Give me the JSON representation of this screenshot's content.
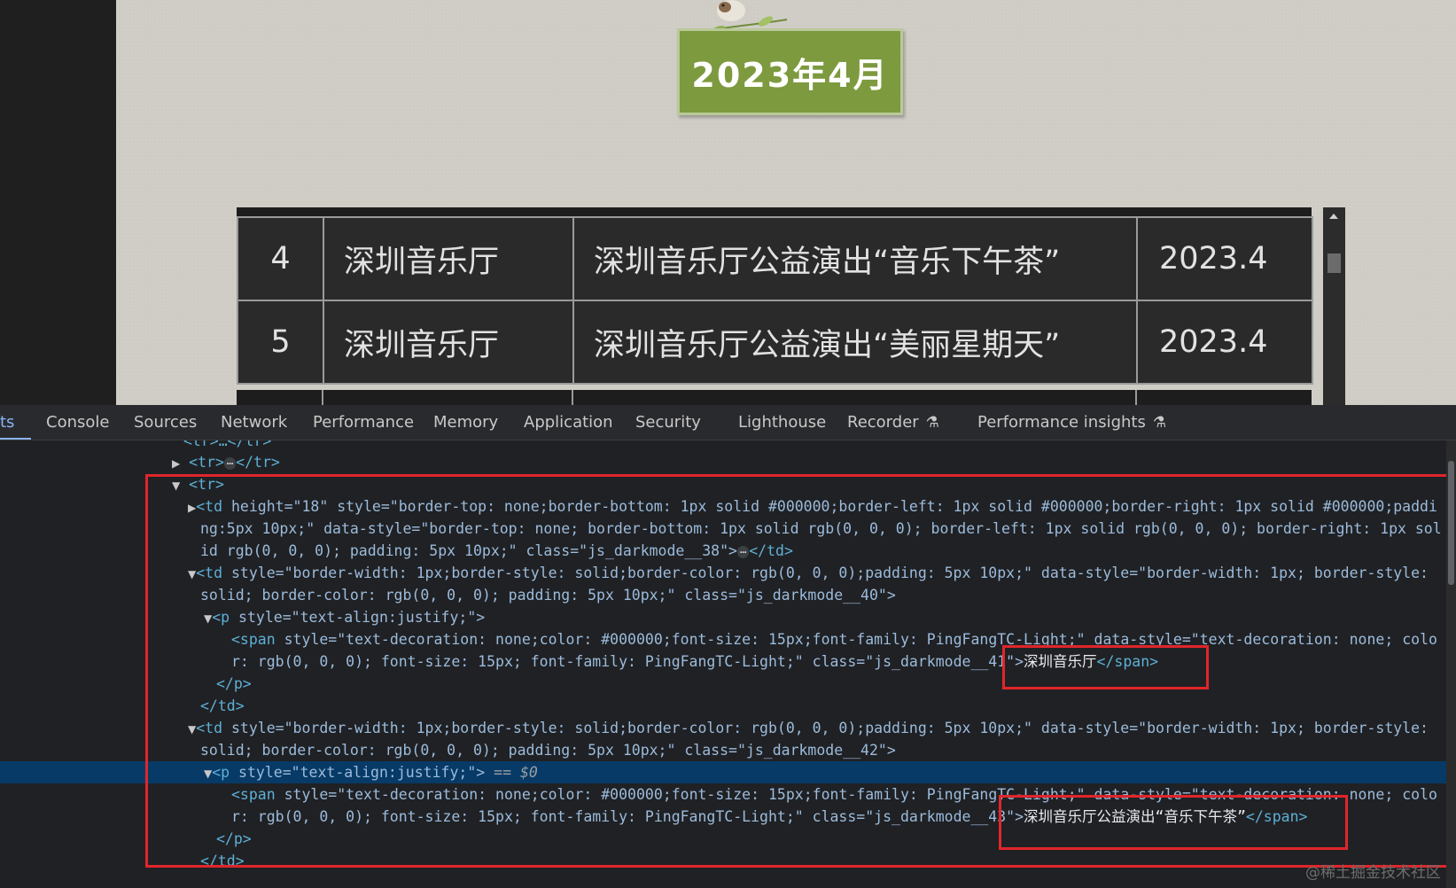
{
  "page": {
    "title": "2023年4月",
    "table_rows": [
      {
        "num": "4",
        "venue": "深圳音乐厅",
        "event": "深圳音乐厅公益演出“音乐下午茶”",
        "date": "2023.4"
      },
      {
        "num": "5",
        "venue": "深圳音乐厅",
        "event": "深圳音乐厅公益演出“美丽星期天”",
        "date": "2023.4"
      }
    ]
  },
  "devtools": {
    "tabs": {
      "elements": "ts",
      "console": "Console",
      "sources": "Sources",
      "network": "Network",
      "performance": "Performance",
      "memory": "Memory",
      "application": "Application",
      "security": "Security",
      "lighthouse": "Lighthouse",
      "recorder": "Recorder",
      "performance_insights": "Performance insights"
    },
    "dom": {
      "l0": "<tr>…</tr>",
      "l1": "<tr>",
      "l1b": "</tr>",
      "l2_open": "<tr>",
      "l3_td_attrs": "height=\"18\" style=\"border-top: none;border-bottom: 1px solid #000000;border-left: 1px solid #000000;border-right: 1px solid #000000;paddi",
      "l3_cont1": "ng:5px 10px;\" data-style=\"border-top: none; border-bottom: 1px solid rgb(0, 0, 0); border-left: 1px solid rgb(0, 0, 0); border-right: 1px sol",
      "l3_cont2": "id rgb(0, 0, 0); padding: 5px 10px;\" class=\"js_darkmode__38\">",
      "l4_td_attrs": "style=\"border-width: 1px;border-style: solid;border-color: rgb(0, 0, 0);padding: 5px 10px;\" data-style=\"border-width: 1px; border-style:",
      "l4_cont": "solid; border-color: rgb(0, 0, 0); padding: 5px 10px;\" class=\"js_darkmode__40\">",
      "l5_p": "style=\"text-align:justify;\">",
      "l6_span": "style=\"text-decoration: none;color: #000000;font-size: 15px;font-family: PingFangTC-Light;\" data-style=\"text-decoration: none; colo",
      "l6_cont": "r: rgb(0, 0, 0); font-size: 15px; font-family: PingFangTC-Light;\" class=\"js_darkmode__41\">",
      "l6_text": "深圳音乐厅",
      "l9_td_attrs": "style=\"border-width: 1px;border-style: solid;border-color: rgb(0, 0, 0);padding: 5px 10px;\" data-style=\"border-width: 1px; border-style:",
      "l9_cont": "solid; border-color: rgb(0, 0, 0); padding: 5px 10px;\" class=\"js_darkmode__42\">",
      "l10_p": "style=\"text-align:justify;\">",
      "l10_marker": "== $0",
      "l11_span": "style=\"text-decoration: none;color: #000000;font-size: 15px;font-family: PingFangTC-Light;\" data-style=\"text-decoration: none; colo",
      "l11_cont": "r: rgb(0, 0, 0); font-size: 15px; font-family: PingFangTC-Light;\" class=\"js_darkmode__43\">",
      "l11_text": "深圳音乐厅公益演出“音乐下午茶”"
    }
  },
  "watermark": "@稀土掘金技术社区",
  "colors": {
    "title_bg": "#7d9a3f",
    "highlight_box": "#e0262b",
    "selected_row": "#073a66"
  }
}
